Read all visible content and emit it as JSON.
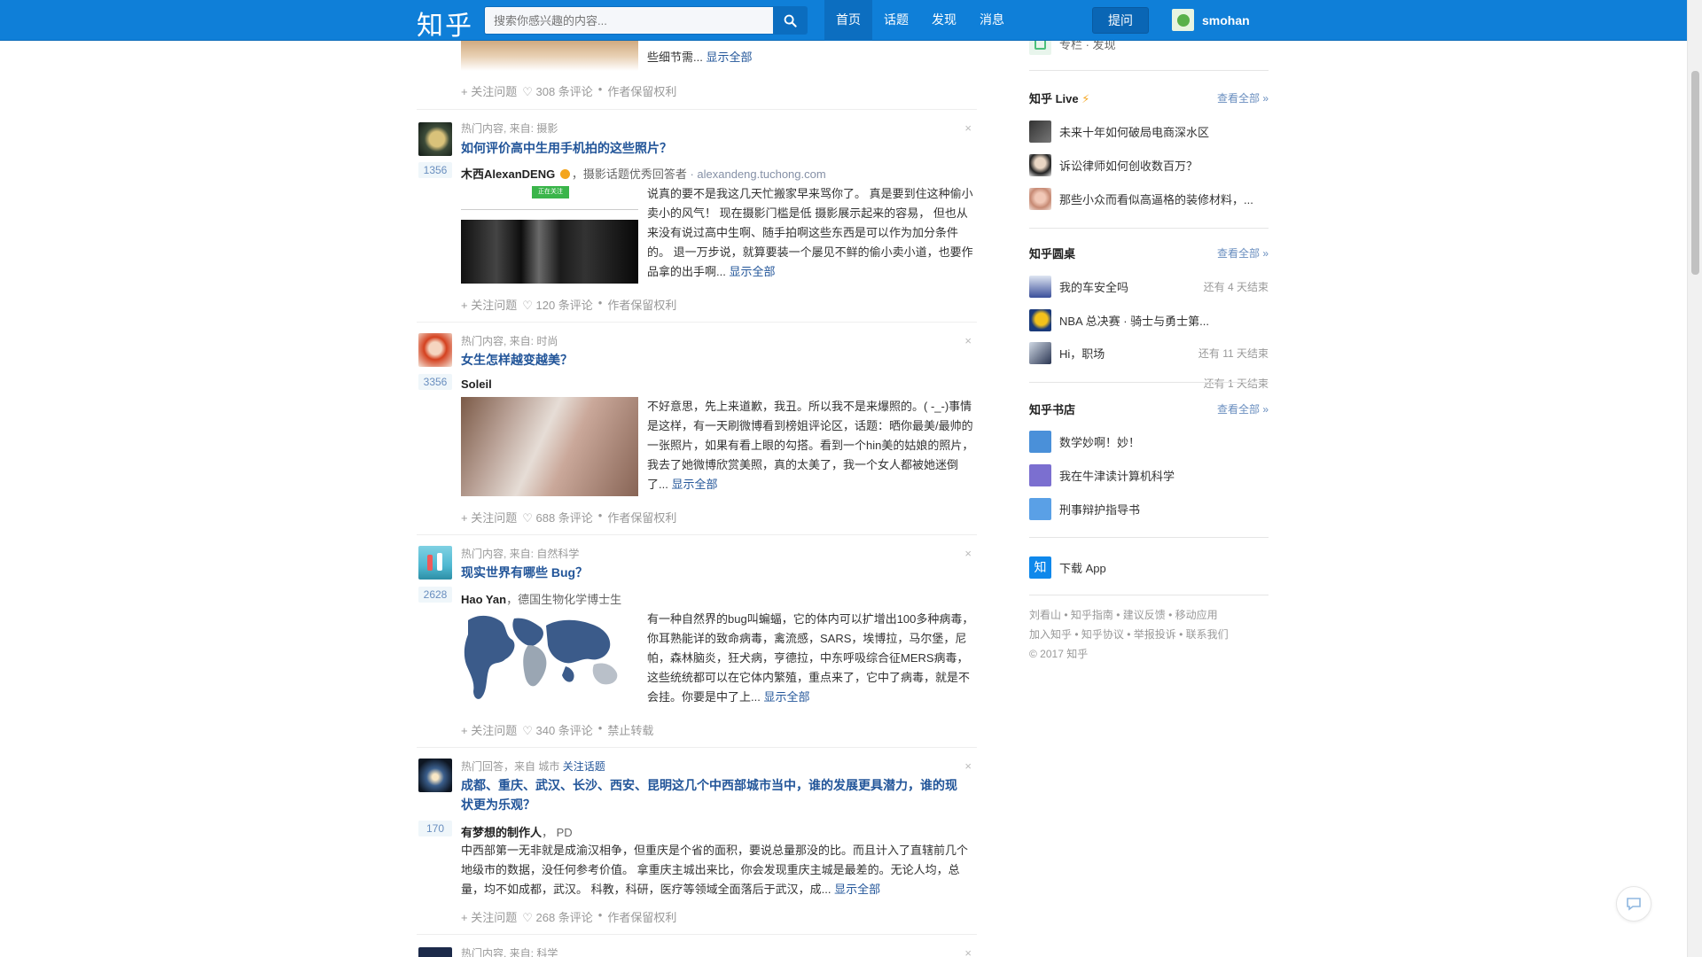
{
  "header": {
    "logo": "知乎",
    "search_placeholder": "搜索你感兴趣的内容...",
    "nav": [
      "首页",
      "话题",
      "发现",
      "消息"
    ],
    "ask": "提问",
    "username": "smohan"
  },
  "feed": {
    "top_card": {
      "excerpt": "些细节需...",
      "more": "显示全部",
      "follow": "+ 关注问题",
      "comments": "♡ 308 条评论",
      "rights": "作者保留权利"
    },
    "cards": [
      {
        "meta": "热门内容, 来自: 摄影",
        "title": "如何评价高中生用手机拍的这些照片？",
        "votes": "1356",
        "author": "木西AlexanDENG",
        "bio": "，摄影话题优秀回答者",
        "site": "· alexandeng.tuchong.com",
        "excerpt": "说真的要不是我这几天忙搬家早来骂你了。 真是要到住这种偷小卖小的风气！ 现在摄影门槛是低 摄影展示起来的容易， 但也从来没有说过高中生啊、随手拍啊这些东西是可以作为加分条件的。 退一万步说，就算要装一个屡见不鲜的偷小卖小道，也要作品拿的出手啊...",
        "more": "显示全部",
        "follow": "+ 关注问题",
        "comments": "♡ 120 条评论",
        "rights": "作者保留权利",
        "thumb_badge": "正在关注"
      },
      {
        "meta": "热门内容, 来自: 时尚",
        "title": "女生怎样越变越美？",
        "votes": "3356",
        "author": "Soleil",
        "excerpt": "不好意思，先上来道歉，我丑。所以我不是来爆照的。( -_-)事情是这样，有一天刷微博看到榜姐评论区，话题：晒你最美/最帅的一张照片，如果有看上眼的勾搭。看到一个hin美的姑娘的照片，我去了她微博欣赏美照，真的太美了，我一个女人都被她迷倒了...",
        "more": "显示全部",
        "follow": "+ 关注问题",
        "comments": "♡ 688 条评论",
        "rights": "作者保留权利"
      },
      {
        "meta": "热门内容, 来自: 自然科学",
        "title": "现实世界有哪些 Bug？",
        "votes": "2628",
        "author": "Hao Yan",
        "bio": "，德国生物化学博士生",
        "excerpt": "有一种自然界的bug叫蝙蝠，它的体内可以扩增出100多种病毒，你耳熟能详的致命病毒，禽流感，SARS，埃博拉，马尔堡，尼帕，森林脑炎，狂犬病，亨德拉，中东呼吸综合征MERS病毒，这些统统都可以在它体内繁殖，重点来了，它中了病毒，就是不会挂。你要是中了上...",
        "more": "显示全部",
        "follow": "+ 关注问题",
        "comments": "♡ 340 条评论",
        "rights": "禁止转载"
      },
      {
        "meta": "热门回答，来自 城市",
        "meta_link": "关注话题",
        "title": "成都、重庆、武汉、长沙、西安、昆明这几个中西部城市当中，谁的发展更具潜力，谁的现状更为乐观？",
        "votes": "170",
        "author": "有梦想的制作人",
        "bio": "， PD",
        "excerpt": "中西部第一无非就是成渝汉相争，但重庆是个省的面积，要说总量那没的比。而且计入了直辖前几个地级市的数据，没任何参考价值。 拿重庆主城出来比，你会发现重庆主城是最差的。无论人均，总量，均不如成都，武汉。 科教，科研，医疗等领域全面落后于武汉，成...",
        "more": "显示全部",
        "follow": "+ 关注问题",
        "comments": "♡ 268 条评论",
        "rights": "作者保留权利"
      },
      {
        "meta": "热门内容, 来自: 科学"
      }
    ]
  },
  "sidebar": {
    "top_item": "专栏 · 发现",
    "live": {
      "title": "知乎 Live",
      "all": "查看全部 »",
      "items": [
        "未来十年如何破局电商深水区",
        "诉讼律师如何创收数百万？",
        "那些小众而看似高逼格的装修材料，..."
      ]
    },
    "roundtable": {
      "title": "知乎圆桌",
      "all": "查看全部 »",
      "items": [
        {
          "label": "我的车安全吗",
          "status": "还有 4 天结束"
        },
        {
          "label": "NBA 总决赛 · 骑士与勇士第...",
          "status": ""
        },
        {
          "label": "Hi，职场",
          "status": "还有 11 天结束"
        }
      ],
      "extra_status": "还有 1 天结束"
    },
    "bookstore": {
      "title": "知乎书店",
      "all": "查看全部 »",
      "items": [
        "数学妙啊！妙！",
        "我在牛津读计算机科学",
        "刑事辩护指导书"
      ]
    },
    "download": "下载 App",
    "footer": {
      "row1": [
        "刘看山",
        "知乎指南",
        "建议反馈",
        "移动应用"
      ],
      "row2": [
        "加入知乎",
        "知乎协议",
        "举报投诉",
        "联系我们"
      ],
      "copyright": "© 2017 知乎"
    }
  },
  "colors": {
    "brand": "#0f7fd8",
    "link": "#225599",
    "vote_bg": "#eff6fa"
  }
}
